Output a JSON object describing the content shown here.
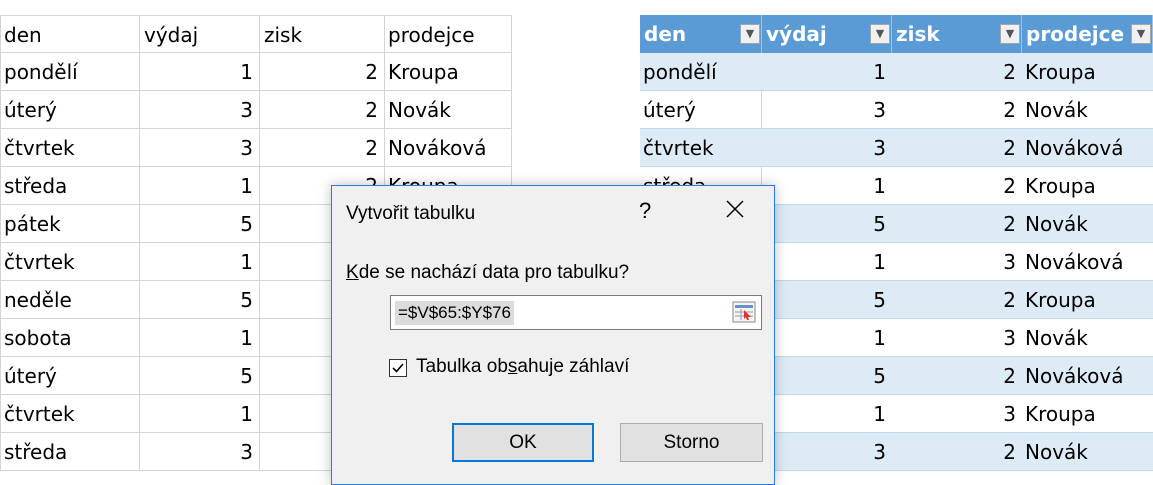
{
  "plain_table": {
    "headers": [
      "den",
      "výdaj",
      "zisk",
      "prodejce"
    ],
    "rows": [
      [
        "pondělí",
        "1",
        "2",
        "Kroupa"
      ],
      [
        "úterý",
        "3",
        "2",
        "Novák"
      ],
      [
        "čtvrtek",
        "3",
        "2",
        "Nováková"
      ],
      [
        "středa",
        "1",
        "2",
        "Kroupa"
      ],
      [
        "pátek",
        "5",
        "",
        ""
      ],
      [
        "čtvrtek",
        "1",
        "",
        ""
      ],
      [
        "neděle",
        "5",
        "",
        ""
      ],
      [
        "sobota",
        "1",
        "",
        ""
      ],
      [
        "úterý",
        "5",
        "",
        ""
      ],
      [
        "čtvrtek",
        "1",
        "",
        ""
      ],
      [
        "středa",
        "3",
        "",
        ""
      ]
    ]
  },
  "excel_table": {
    "headers": [
      "den",
      "výdaj",
      "zisk",
      "prodejce"
    ],
    "rows": [
      [
        "pondělí",
        "1",
        "2",
        "Kroupa"
      ],
      [
        "úterý",
        "3",
        "2",
        "Novák"
      ],
      [
        "čtvrtek",
        "3",
        "2",
        "Nováková"
      ],
      [
        "středa",
        "1",
        "2",
        "Kroupa"
      ],
      [
        "",
        "5",
        "2",
        "Novák"
      ],
      [
        "",
        "1",
        "3",
        "Nováková"
      ],
      [
        "",
        "5",
        "2",
        "Kroupa"
      ],
      [
        "",
        "1",
        "3",
        "Novák"
      ],
      [
        "",
        "5",
        "2",
        "Nováková"
      ],
      [
        "",
        "1",
        "3",
        "Kroupa"
      ],
      [
        "",
        "3",
        "2",
        "Novák"
      ]
    ],
    "header_color": "#5b9bd5",
    "band_color": "#ddebf7"
  },
  "dialog": {
    "title": "Vytvořit tabulku",
    "help_label": "?",
    "prompt_prefix": "K",
    "prompt_rest": "de se nachází data pro tabulku?",
    "range_value": "=$V$65:$Y$76",
    "checkbox_checked": true,
    "checkbox_label_pre": "Tabulka ob",
    "checkbox_label_ul": "s",
    "checkbox_label_post": "ahuje záhlaví",
    "ok_label": "OK",
    "cancel_label": "Storno",
    "accent_color": "#0078d7"
  }
}
